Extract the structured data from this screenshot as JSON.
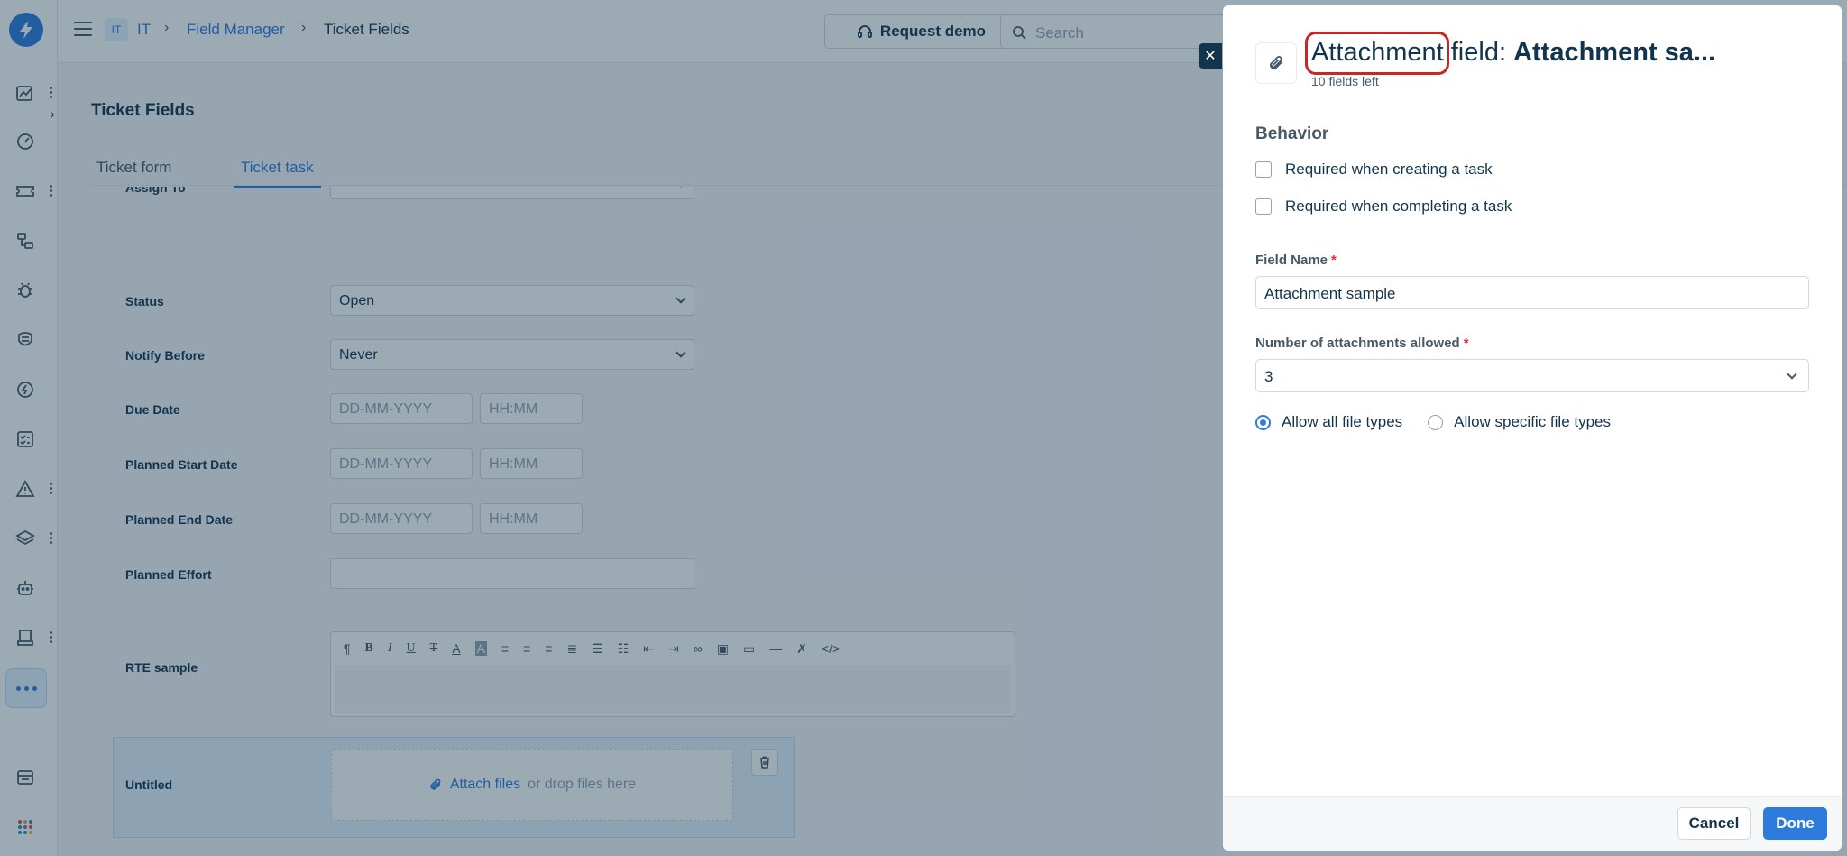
{
  "topbar": {
    "workspace_badge": "IT",
    "breadcrumbs": [
      "IT",
      "Field Manager",
      "Ticket Fields"
    ],
    "request_demo": "Request demo",
    "search_placeholder": "Search"
  },
  "page": {
    "title": "Ticket Fields",
    "tabs": [
      "Ticket form",
      "Ticket task"
    ],
    "active_tab": "Ticket task"
  },
  "form": {
    "assign_to_label": "Assign To",
    "status": {
      "label": "Status",
      "value": "Open"
    },
    "notify_before": {
      "label": "Notify Before",
      "value": "Never"
    },
    "due_date": {
      "label": "Due Date",
      "date_placeholder": "DD-MM-YYYY",
      "time_placeholder": "HH:MM"
    },
    "planned_start_date": {
      "label": "Planned Start Date",
      "date_placeholder": "DD-MM-YYYY",
      "time_placeholder": "HH:MM"
    },
    "planned_end_date": {
      "label": "Planned End Date",
      "date_placeholder": "DD-MM-YYYY",
      "time_placeholder": "HH:MM"
    },
    "planned_effort": {
      "label": "Planned Effort"
    },
    "rte_sample": {
      "label": "RTE sample"
    },
    "untitled": {
      "label": "Untitled",
      "attach_link": "Attach files",
      "drop_text": "or drop files here"
    }
  },
  "drawer": {
    "title_type": "Attachment",
    "title_mid": " field: ",
    "title_name": "Attachment sa...",
    "subtitle": "10 fields left",
    "behavior_title": "Behavior",
    "checkboxes": [
      "Required when creating a task",
      "Required when completing a task"
    ],
    "field_name_label": "Field Name",
    "field_name_value": "Attachment sample",
    "num_attachments_label": "Number of attachments allowed",
    "num_attachments_value": "3",
    "radio_options": [
      "Allow all file types",
      "Allow specific file types"
    ],
    "radio_selected": "Allow all file types",
    "cancel": "Cancel",
    "done": "Done"
  },
  "colors": {
    "accent": "#2d7bdc",
    "text": "#12344d",
    "highlight_box": "#c62828"
  }
}
